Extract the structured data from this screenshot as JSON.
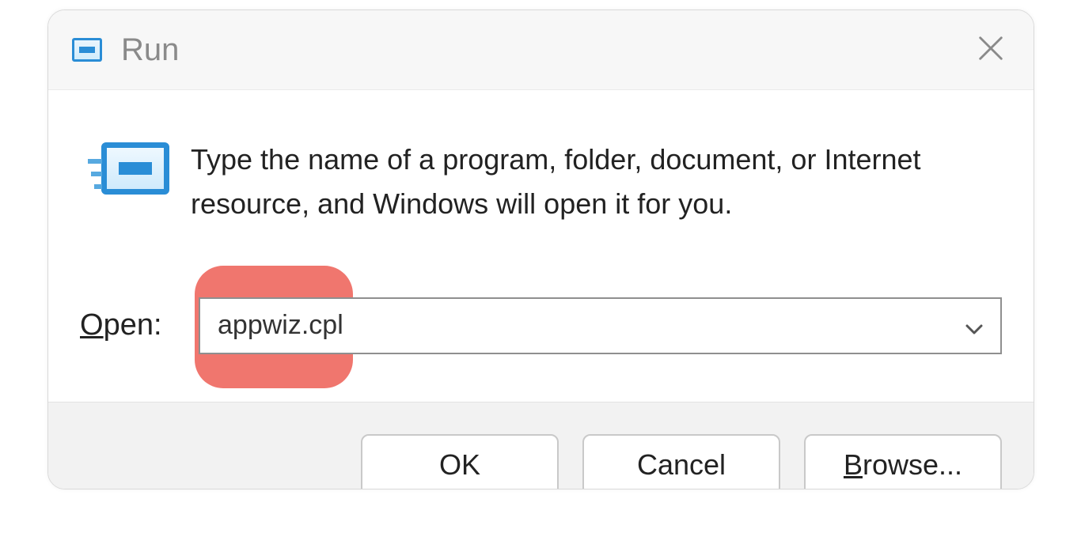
{
  "title": "Run",
  "intro": "Type the name of a program, folder, document, or Internet resource, and Windows will open it for you.",
  "open_label_char": "O",
  "open_label_rest": "pen:",
  "combo_value": "appwiz.cpl",
  "buttons": {
    "ok": "OK",
    "cancel": "Cancel",
    "browse_char": "B",
    "browse_rest": "rowse..."
  }
}
